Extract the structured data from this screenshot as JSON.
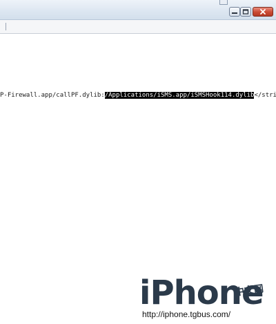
{
  "window": {
    "controls": {
      "minimize_icon": "minimize-icon",
      "maximize_icon": "maximize-icon",
      "close_icon": "close-icon"
    }
  },
  "editor": {
    "line": {
      "before": "P-Firewall.app/callPF.dylib:",
      "selected": "/Applications/iSMS.app/iSMSHook114.dylib",
      "after": "</string>"
    },
    "selection_color": "#000000"
  },
  "watermark": {
    "logo_text": "iPhone",
    "chinese_text": "中文网",
    "url": "http://iphone.tgbus.com/"
  }
}
